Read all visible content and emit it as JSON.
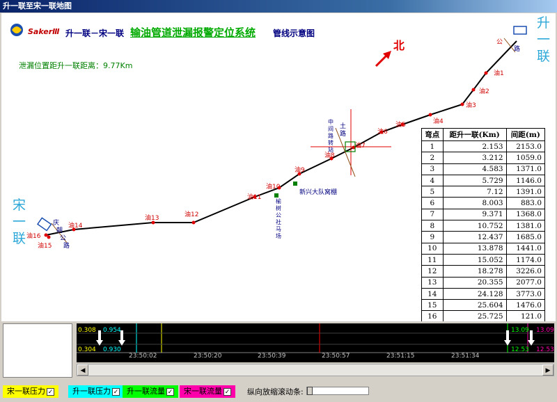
{
  "window": {
    "title": "升一联至宋一联地图"
  },
  "header": {
    "logo_text": "SakerⅢ",
    "route": "升一联－宋一联",
    "system_title": "输油管道泄漏报警定位系统",
    "subtitle": "管线示意图"
  },
  "leak_info": "泄漏位置距升一联距离：9.77Km",
  "north_label": "北",
  "ends": {
    "right": "升一联",
    "left": "宋一联"
  },
  "points": [
    "油1",
    "油2",
    "油3",
    "油4",
    "油5",
    "油6",
    "油7",
    "油8",
    "油9",
    "油10",
    "油11",
    "油12",
    "油13",
    "油14",
    "油15",
    "油16"
  ],
  "roads": {
    "top_right": [
      "公",
      "路"
    ],
    "left": [
      "庆",
      "朝",
      "公",
      "路"
    ],
    "mid_road_1": "中 间 路 转 站",
    "mid_road_2": "土 路",
    "village_1": "新兴大队窝棚",
    "village_2": "榆树公社马场"
  },
  "table": {
    "headers": [
      "弯点",
      "距升一联(Km)",
      "间距(m)"
    ],
    "rows": [
      [
        "1",
        "2.153",
        "2153.0"
      ],
      [
        "2",
        "3.212",
        "1059.0"
      ],
      [
        "3",
        "4.583",
        "1371.0"
      ],
      [
        "4",
        "5.729",
        "1146.0"
      ],
      [
        "5",
        "7.12",
        "1391.0"
      ],
      [
        "6",
        "8.003",
        "883.0"
      ],
      [
        "7",
        "9.371",
        "1368.0"
      ],
      [
        "8",
        "10.752",
        "1381.0"
      ],
      [
        "9",
        "12.437",
        "1685.0"
      ],
      [
        "10",
        "13.878",
        "1441.0"
      ],
      [
        "11",
        "15.052",
        "1174.0"
      ],
      [
        "12",
        "18.278",
        "3226.0"
      ],
      [
        "13",
        "20.355",
        "2077.0"
      ],
      [
        "14",
        "24.128",
        "3773.0"
      ],
      [
        "15",
        "25.604",
        "1476.0"
      ],
      [
        "16",
        "25.725",
        "121.0"
      ]
    ]
  },
  "trend": {
    "left_values": [
      "0.308",
      "0.304"
    ],
    "left_values_2": [
      "0.954",
      "0.930"
    ],
    "right_values": [
      "13.09",
      "12.53"
    ],
    "right_values_2": [
      "13.09",
      "12.53"
    ],
    "times": [
      "23:50:02",
      "23:50:20",
      "23:50:39",
      "23:50:57",
      "23:51:15",
      "23:51:34"
    ]
  },
  "legend": [
    {
      "label": "宋一联压力",
      "color": "#ffff00",
      "checked": "✓"
    },
    {
      "label": "升一联压力",
      "color": "#00ffff",
      "checked": "✓"
    },
    {
      "label": "升一联流量",
      "color": "#00ff00",
      "checked": "✓"
    },
    {
      "label": "宋一联流量",
      "color": "#ff00aa",
      "checked": "✓"
    }
  ],
  "scroll_label": "纵向放缩滚动条:"
}
